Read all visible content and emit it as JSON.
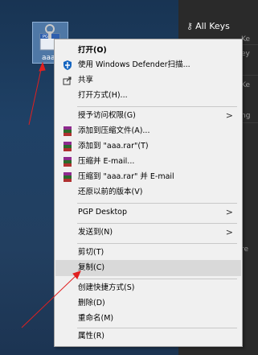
{
  "desktop": {
    "file_label": "aaa",
    "right_panel_title": "All Keys",
    "right_panel_fragments": [
      "Ke",
      "ey",
      "Ke",
      "ng",
      "re"
    ]
  },
  "menu": {
    "items": [
      {
        "label": "打开(O)",
        "bold": true,
        "icon": "none"
      },
      {
        "label": "使用 Windows Defender扫描...",
        "icon": "windows-defender-icon"
      },
      {
        "label": "共享",
        "icon": "share-icon"
      },
      {
        "label": "打开方式(H)...",
        "icon": "none"
      },
      {
        "label": "授予访问权限(G)",
        "icon": "none",
        "submenu": true
      },
      {
        "label": "添加到压缩文件(A)...",
        "icon": "winrar-icon"
      },
      {
        "label": "添加到 \"aaa.rar\"(T)",
        "icon": "winrar-icon"
      },
      {
        "label": "压缩并 E-mail...",
        "icon": "winrar-icon"
      },
      {
        "label": "压缩到 \"aaa.rar\" 并 E-mail",
        "icon": "winrar-icon"
      },
      {
        "label": "还原以前的版本(V)",
        "icon": "none"
      },
      {
        "label": "PGP Desktop",
        "icon": "none",
        "submenu": true
      },
      {
        "label": "发送到(N)",
        "icon": "none",
        "submenu": true
      },
      {
        "label": "剪切(T)",
        "icon": "none"
      },
      {
        "label": "复制(C)",
        "icon": "none",
        "highlighted": true
      },
      {
        "label": "创建快捷方式(S)",
        "icon": "none"
      },
      {
        "label": "删除(D)",
        "icon": "none"
      },
      {
        "label": "重命名(M)",
        "icon": "none"
      },
      {
        "label": "属性(R)",
        "icon": "none"
      }
    ],
    "submenu_arrow": ">"
  },
  "colors": {
    "annotation": "#e02020",
    "menu_bg": "#f0f0f0",
    "highlight": "#d9d9d9"
  }
}
